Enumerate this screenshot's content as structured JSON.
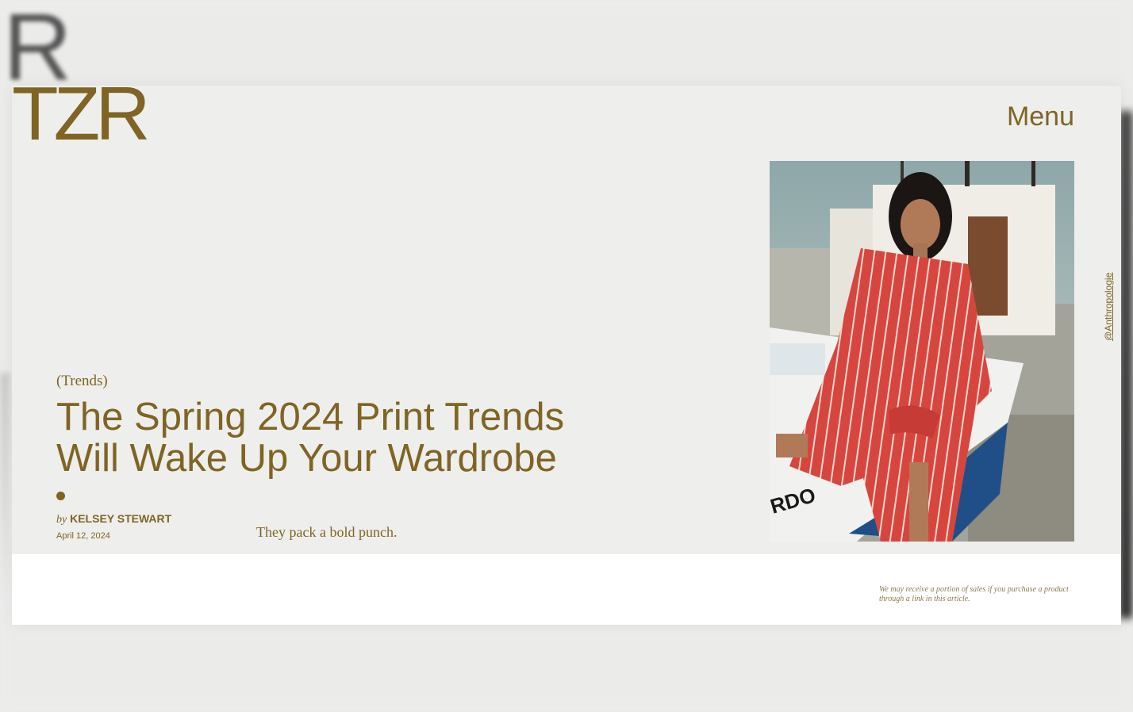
{
  "site": {
    "logo_text": "TZR",
    "menu_label": "Menu"
  },
  "article": {
    "category": "(Trends)",
    "title": "The Spring 2024 Print Trends Will Wake Up Your Wardrobe",
    "byline_prefix": "by",
    "author": "KELSEY STEWART",
    "date": "April 12, 2024",
    "dek": "They pack a bold punch."
  },
  "hero_image": {
    "credit": "@Anthropologie"
  },
  "disclaimer": "We may receive a portion of sales if you purchase a product through a link in this article.",
  "colors": {
    "accent": "#7f6424",
    "panel": "#eeeeec",
    "white": "#ffffff"
  },
  "icons": [
    "byline-dot-icon"
  ]
}
